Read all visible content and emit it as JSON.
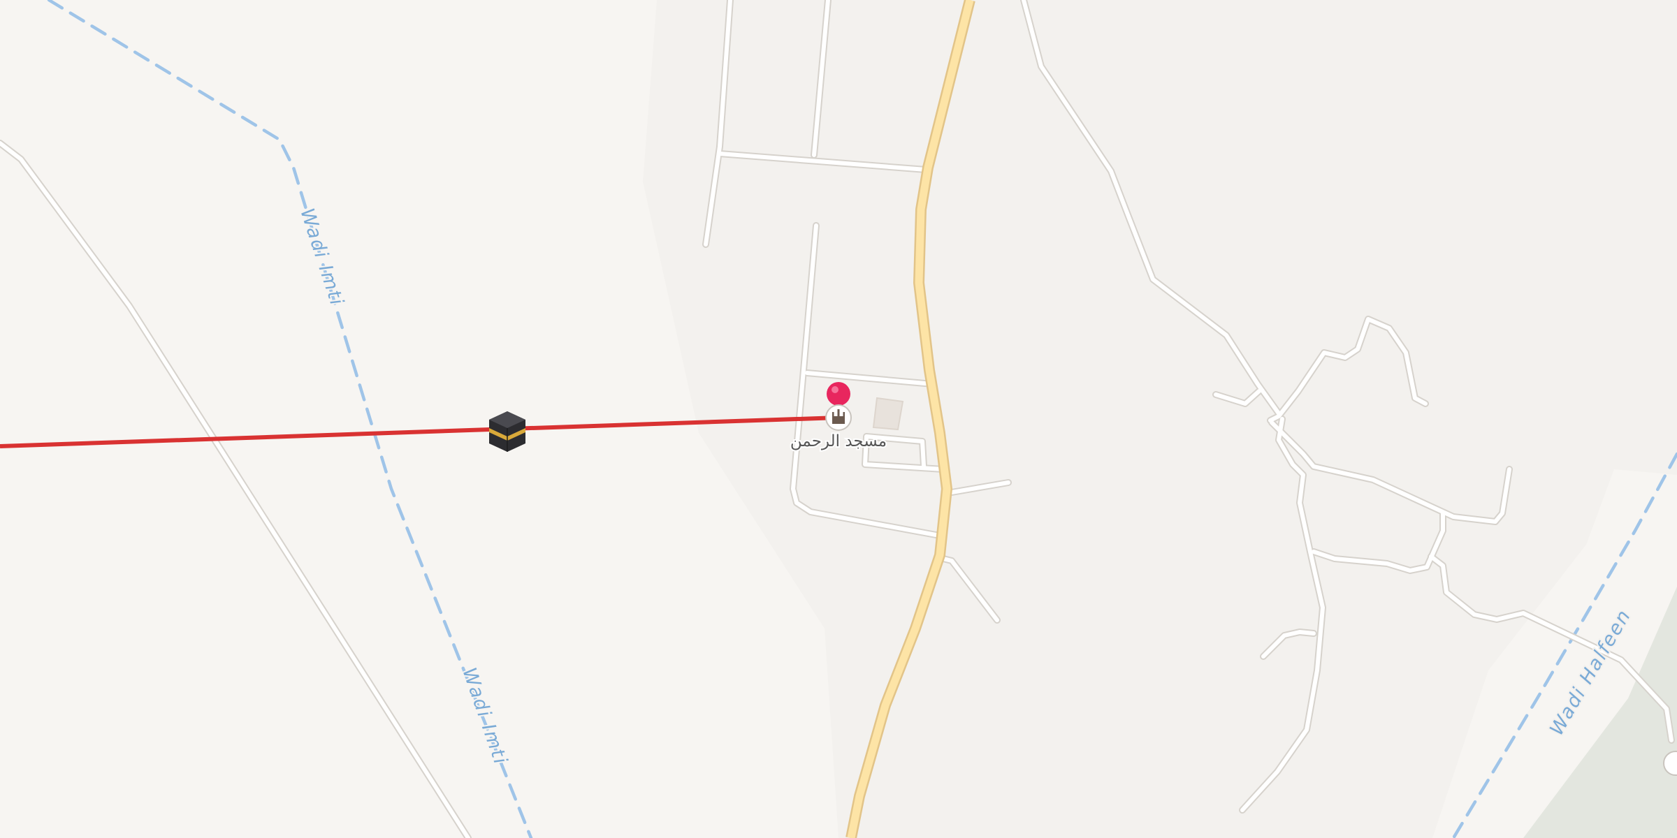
{
  "map": {
    "poi": {
      "name": "مسجد الرحمن",
      "icon": "mosque-icon"
    },
    "waterways": [
      {
        "name": "Wadi Imti"
      },
      {
        "name": "Wadi Imti"
      },
      {
        "name": "Wadi Halfeen"
      }
    ],
    "markers": {
      "pin": "location-pin-icon",
      "kaaba": "kaaba-icon",
      "qibla_line": "qibla-direction-line"
    },
    "colors": {
      "background": "#f7f5f2",
      "road_outline": "#d8d4cf",
      "road_fill": "#ffffff",
      "main_road_fill": "#fde3a3",
      "main_road_outline": "#e6c887",
      "waterway": "#9fc4e8",
      "waterway_label": "#7aaad6",
      "qibla_line": "#d93232",
      "pin": "#e8265e",
      "park": "#e2e6df"
    }
  }
}
